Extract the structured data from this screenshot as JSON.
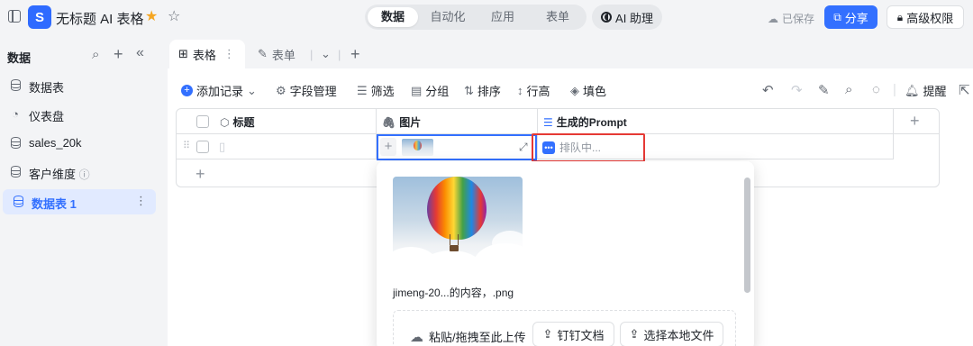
{
  "app": {
    "title": "无标题 AI 表格",
    "logo": "S"
  },
  "top_tabs": [
    {
      "label": "数据",
      "active": true
    },
    {
      "label": "自动化",
      "active": false
    },
    {
      "label": "应用",
      "active": false
    },
    {
      "label": "表单",
      "active": false
    }
  ],
  "ai_button": "AI 助理",
  "saved_status": "已保存",
  "share_button": "分享",
  "permission_button": "高级权限",
  "sidebar": {
    "title": "数据",
    "items": [
      {
        "label": "数据表",
        "icon": "database-icon"
      },
      {
        "label": "仪表盘",
        "icon": "dashboard-icon"
      },
      {
        "label": "sales_20k",
        "icon": "database-icon"
      },
      {
        "label": "客户维度",
        "icon": "database-icon",
        "info": "ⓘ"
      },
      {
        "label": "数据表 1",
        "icon": "database-icon",
        "active": true
      }
    ]
  },
  "view_tabs": [
    {
      "label": "表格",
      "active": true
    },
    {
      "label": "表单",
      "active": false
    }
  ],
  "toolbar": {
    "add_record": "添加记录",
    "field_manage": "字段管理",
    "filter": "筛选",
    "group": "分组",
    "sort": "排序",
    "row_height": "行高",
    "fill": "填色",
    "remind": "提醒"
  },
  "grid": {
    "columns": [
      "标题",
      "图片",
      "生成的Prompt"
    ],
    "rows": [
      {
        "title": "",
        "image": "balloon-thumbnail",
        "prompt_status": "排队中..."
      }
    ]
  },
  "popup": {
    "filename": "jimeng-20...的内容，.png",
    "drop_hint": "粘贴/拖拽至此上传",
    "btn_dingtalk": "钉钉文档",
    "btn_local": "选择本地文件"
  },
  "colors": {
    "accent": "#3370ff",
    "highlight": "#e53935"
  }
}
